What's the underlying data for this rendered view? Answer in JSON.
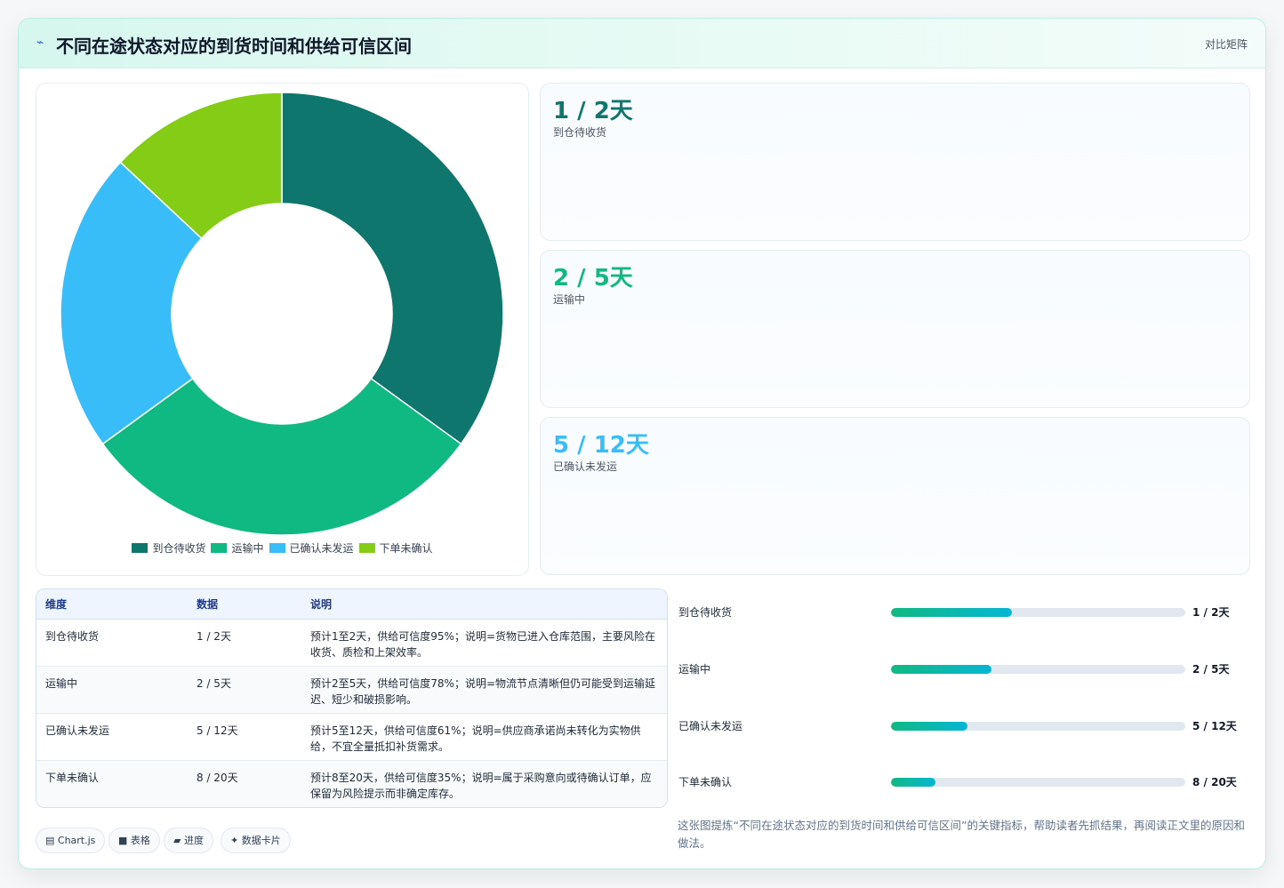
{
  "header": {
    "icon": "sparkle-icon",
    "title": "不同在途状态对应的到货时间和供给可信区间",
    "tag": "对比矩阵"
  },
  "chart_data": {
    "type": "pie",
    "variant": "doughnut",
    "categories": [
      "到仓待收货",
      "运输中",
      "已确认未发运",
      "下单未确认"
    ],
    "values": [
      35,
      30,
      22,
      13
    ],
    "colors": [
      "#0f766e",
      "#10b981",
      "#38bdf8",
      "#84cc16"
    ],
    "legend_position": "bottom"
  },
  "stats": [
    {
      "value": "1 / 2天",
      "label": "到仓待收货",
      "color": "#0f766e"
    },
    {
      "value": "2 / 5天",
      "label": "运输中",
      "color": "#10b981"
    },
    {
      "value": "5 / 12天",
      "label": "已确认未发运",
      "color": "#38bdf8"
    }
  ],
  "table": {
    "headers": [
      "维度",
      "数据",
      "说明"
    ],
    "rows": [
      [
        "到仓待收货",
        "1 / 2天",
        "预计1至2天，供给可信度95%；说明=货物已进入仓库范围，主要风险在收货、质检和上架效率。"
      ],
      [
        "运输中",
        "2 / 5天",
        "预计2至5天，供给可信度78%；说明=物流节点清晰但仍可能受到运输延迟、短少和破损影响。"
      ],
      [
        "已确认未发运",
        "5 / 12天",
        "预计5至12天，供给可信度61%；说明=供应商承诺尚未转化为实物供给，不宜全量抵扣补货需求。"
      ],
      [
        "下单未确认",
        "8 / 20天",
        "预计8至20天，供给可信度35%；说明=属于采购意向或待确认订单，应保留为风险提示而非确定库存。"
      ]
    ]
  },
  "progress": [
    {
      "label": "到仓待收货",
      "value": "1 / 2天",
      "fraction": 0.41
    },
    {
      "label": "运输中",
      "value": "2 / 5天",
      "fraction": 0.34
    },
    {
      "label": "已确认未发运",
      "value": "5 / 12天",
      "fraction": 0.26
    },
    {
      "label": "下单未确认",
      "value": "8 / 20天",
      "fraction": 0.15
    }
  ],
  "chips": [
    "▤ Chart.js",
    "■ 表格",
    "▰ 进度",
    "✦ 数据卡片"
  ],
  "note": "这张图提炼“不同在途状态对应的到货时间和供给可信区间”的关键指标，帮助读者先抓结果，再阅读正文里的原因和做法。"
}
